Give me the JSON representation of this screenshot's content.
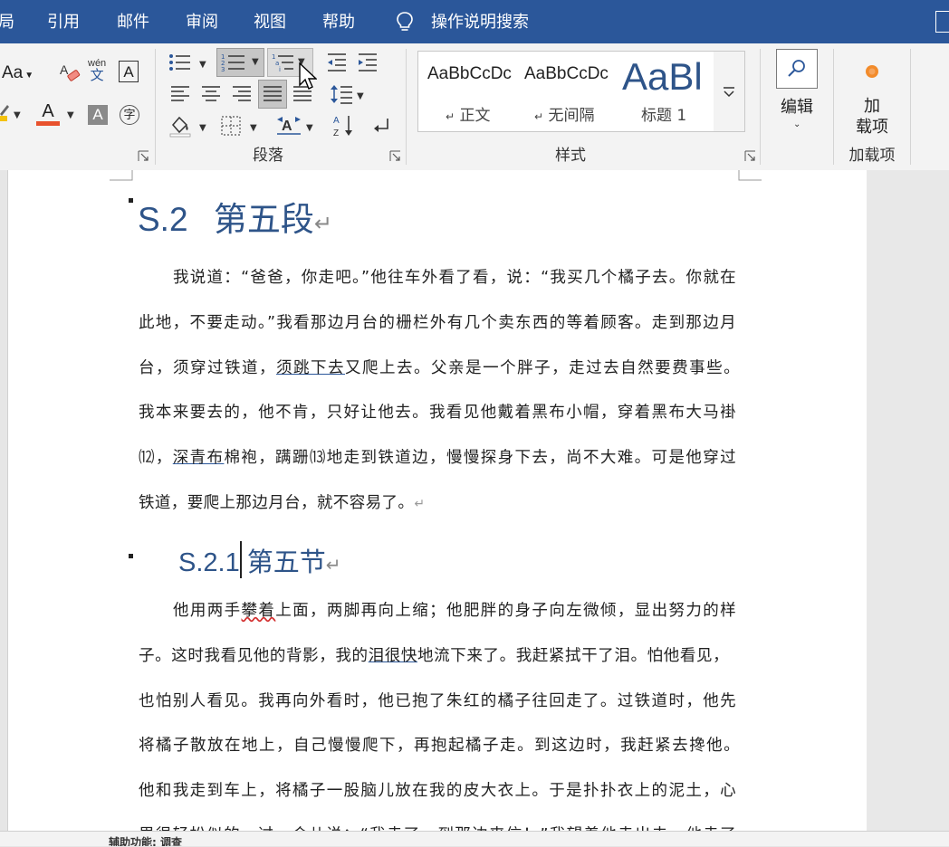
{
  "tabs": {
    "layout_partial": "局",
    "references": "引用",
    "mailings": "邮件",
    "review": "审阅",
    "view": "视图",
    "help": "帮助",
    "tell_me": "操作说明搜索"
  },
  "ribbon": {
    "font": {
      "change_case": "Aa",
      "phonetic_top": "wén",
      "phonetic_bottom": "文",
      "char_border": "A",
      "font_color": "A",
      "char_shading": "A",
      "enclose_char": "字"
    },
    "paragraph": {
      "label": "段落"
    },
    "styles": {
      "label": "样式",
      "items": [
        {
          "sample": "AaBbCcDc",
          "name": "正文"
        },
        {
          "sample": "AaBbCcDc",
          "name": "无间隔"
        },
        {
          "sample": "AaBl",
          "name": "标题 1"
        }
      ]
    },
    "editing": {
      "label": "编辑"
    },
    "addins": {
      "label_top": "加",
      "label_bottom": "载项",
      "group_label": "加载项"
    }
  },
  "document": {
    "heading_s2": {
      "number": "S.2",
      "title": "第五段",
      "mark": "↵"
    },
    "paragraph1": [
      {
        "text": "我说道：“爸爸，你走吧。”他往车外看了看，说：“我买几个橘子去。你就在"
      },
      {
        "text": "此地，不要走动。”我看那边月台的栅栏外有几个卖东西的等着顾客。走到那边月"
      },
      {
        "pre": "台，须穿过铁道，",
        "underlined": "须跳下去",
        "post": "又爬上去。父亲是一个胖子，走过去自然要费事些。"
      },
      {
        "text": "我本来要去的，他不肯，只好让他去。我看见他戴着黑布小帽，穿着黑布大马褂"
      },
      {
        "pre": "⑿，",
        "underlined": "深青布",
        "post": "棉袍，蹒跚⒀地走到铁道边，慢慢探身下去，尚不大难。可是他穿过"
      },
      {
        "text": "铁道，要爬上那边月台，就不容易了。",
        "mark": "↵"
      }
    ],
    "heading_s21": {
      "number": "S.2.1",
      "title": "第五节",
      "mark": "↵"
    },
    "paragraph2": [
      {
        "pre": "他用两手",
        "wavy": "攀着",
        "post": "上面，两脚再向上缩；他肥胖的身子向左微倾，显出努力的样"
      },
      {
        "pre": "子。这时我看见他的背影，我的",
        "underlined": "泪很快",
        "post": "地流下来了。我赶紧拭干了泪。怕他看见，"
      },
      {
        "text": "也怕别人看见。我再向外看时，他已抱了朱红的橘子往回走了。过铁道时，他先"
      },
      {
        "text": "将橘子散放在地上，自己慢慢爬下，再抱起橘子走。到这边时，我赶紧去搀他。"
      },
      {
        "text": "他和我走到车上，将橘子一股脑儿放在我的皮大衣上。于是扑扑衣上的泥土，心"
      },
      {
        "text": "里很轻松似的，过一会儿说：“我走了，到那边来信！”我望着他走出去。他走了"
      }
    ]
  },
  "status": {
    "text": "辅助功能: 调查"
  },
  "colors": {
    "title_bar": "#2b579a",
    "heading": "#2e5489",
    "font_color_bar": "#e8522d",
    "highlight_bar": "#f4c20d"
  }
}
